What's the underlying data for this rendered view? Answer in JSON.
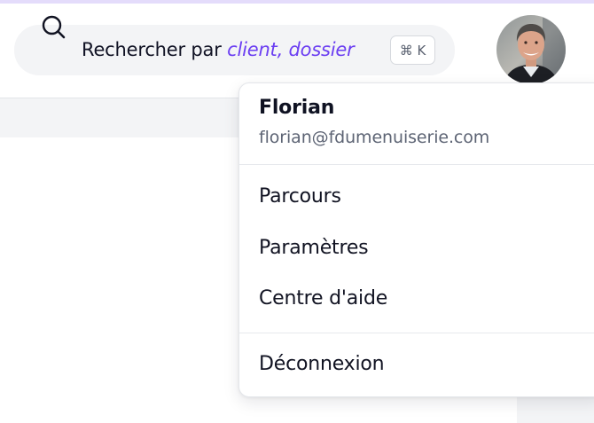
{
  "search": {
    "prefix": "Rechercher par ",
    "emphasis": "client, dossier",
    "shortcut": "⌘ K",
    "accent_color": "#6b3ef2"
  },
  "user": {
    "avatar": "profile-photo"
  },
  "menu": {
    "name": "Florian",
    "email": "florian@fdumenuiserie.com",
    "items": [
      {
        "label": "Parcours"
      },
      {
        "label": "Paramètres"
      },
      {
        "label": "Centre d'aide"
      }
    ],
    "logout": "Déconnexion"
  }
}
